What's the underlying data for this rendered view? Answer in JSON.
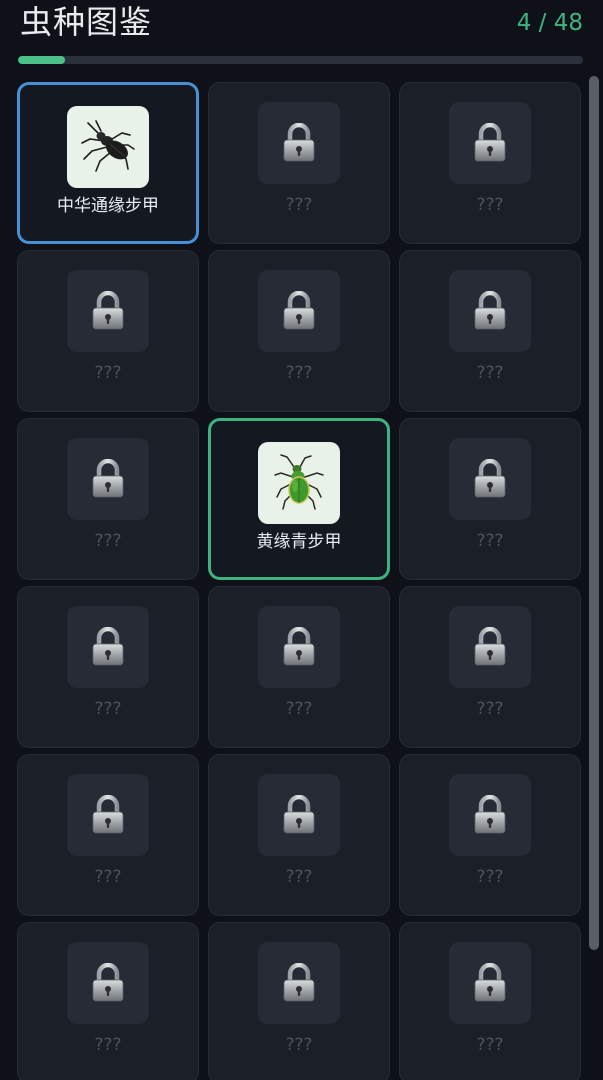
{
  "header": {
    "title": "虫种图鉴",
    "count": "4 / 48"
  },
  "progress": {
    "fraction": 0.083
  },
  "colors": {
    "accent_green": "#3fb37f",
    "select_blue": "#4a8fd6"
  },
  "cards": [
    {
      "state": "unlocked",
      "label": "中华通缘步甲",
      "icon": "black-beetle-icon",
      "highlight": "blue"
    },
    {
      "state": "locked",
      "label": "???",
      "icon": "lock-icon"
    },
    {
      "state": "locked",
      "label": "???",
      "icon": "lock-icon"
    },
    {
      "state": "locked",
      "label": "???",
      "icon": "lock-icon"
    },
    {
      "state": "locked",
      "label": "???",
      "icon": "lock-icon"
    },
    {
      "state": "locked",
      "label": "???",
      "icon": "lock-icon"
    },
    {
      "state": "locked",
      "label": "???",
      "icon": "lock-icon"
    },
    {
      "state": "unlocked",
      "label": "黄缘青步甲",
      "icon": "green-beetle-icon",
      "highlight": "green"
    },
    {
      "state": "locked",
      "label": "???",
      "icon": "lock-icon"
    },
    {
      "state": "locked",
      "label": "???",
      "icon": "lock-icon"
    },
    {
      "state": "locked",
      "label": "???",
      "icon": "lock-icon"
    },
    {
      "state": "locked",
      "label": "???",
      "icon": "lock-icon"
    },
    {
      "state": "locked",
      "label": "???",
      "icon": "lock-icon"
    },
    {
      "state": "locked",
      "label": "???",
      "icon": "lock-icon"
    },
    {
      "state": "locked",
      "label": "???",
      "icon": "lock-icon"
    },
    {
      "state": "locked",
      "label": "???",
      "icon": "lock-icon"
    },
    {
      "state": "locked",
      "label": "???",
      "icon": "lock-icon"
    },
    {
      "state": "locked",
      "label": "???",
      "icon": "lock-icon"
    }
  ]
}
